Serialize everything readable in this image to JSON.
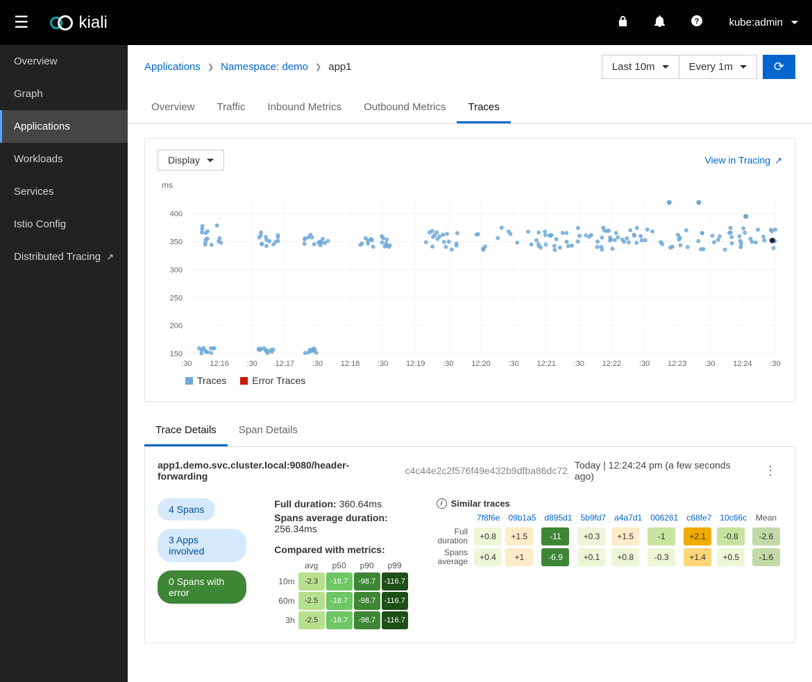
{
  "app_name": "kiali",
  "user": "kube:admin",
  "sidebar": {
    "items": [
      {
        "label": "Overview"
      },
      {
        "label": "Graph"
      },
      {
        "label": "Applications"
      },
      {
        "label": "Workloads"
      },
      {
        "label": "Services"
      },
      {
        "label": "Istio Config"
      },
      {
        "label": "Distributed Tracing"
      }
    ]
  },
  "breadcrumbs": [
    {
      "label": "Applications"
    },
    {
      "label": "Namespace: demo"
    },
    {
      "label": "app1"
    }
  ],
  "time_range": "Last 10m",
  "refresh_interval": "Every 1m",
  "tabs": [
    "Overview",
    "Traffic",
    "Inbound Metrics",
    "Outbound Metrics",
    "Traces"
  ],
  "active_tab": "Traces",
  "display_button": "Display",
  "view_tracing": "View in Tracing",
  "chart_y_label": "ms",
  "legend": {
    "traces": "Traces",
    "errors": "Error Traces"
  },
  "chart_data": {
    "type": "scatter",
    "ylabel": "ms",
    "ylim": [
      150,
      430
    ],
    "y_ticks": [
      150,
      200,
      250,
      300,
      350,
      400
    ],
    "x_ticks": [
      ":30",
      "12:16",
      ":30",
      "12:17",
      ":30",
      "12:18",
      ":30",
      "12:19",
      ":30",
      "12:20",
      ":30",
      "12:21",
      ":30",
      "12:22",
      ":30",
      "12:23",
      ":30",
      "12:24",
      ":30"
    ],
    "series": [
      {
        "name": "Traces",
        "color": "#6ea9d7",
        "approx_count": 260,
        "clusters": [
          {
            "x_range": [
              0.02,
              0.06
            ],
            "y_range": [
              340,
              380
            ]
          },
          {
            "x_range": [
              0.02,
              0.05
            ],
            "y_range": [
              150,
              160
            ]
          },
          {
            "x_range": [
              0.12,
              0.16
            ],
            "y_range": [
              340,
              370
            ]
          },
          {
            "x_range": [
              0.12,
              0.15
            ],
            "y_range": [
              150,
              160
            ]
          },
          {
            "x_range": [
              0.2,
              0.24
            ],
            "y_range": [
              340,
              365
            ]
          },
          {
            "x_range": [
              0.2,
              0.22
            ],
            "y_range": [
              150,
              160
            ]
          },
          {
            "x_range": [
              0.29,
              0.35
            ],
            "y_range": [
              340,
              365
            ]
          },
          {
            "x_range": [
              0.4,
              0.46
            ],
            "y_range": [
              335,
              370
            ]
          },
          {
            "x_range": [
              0.48,
              1.0
            ],
            "y_range": [
              335,
              375
            ]
          }
        ],
        "outliers": [
          {
            "x": 0.82,
            "y": 420
          },
          {
            "x": 0.87,
            "y": 420
          },
          {
            "x": 0.95,
            "y": 395
          }
        ]
      },
      {
        "name": "Error Traces",
        "color": "#c9190b",
        "approx_count": 0,
        "clusters": [],
        "outliers": []
      }
    ]
  },
  "detail_tabs": [
    "Trace Details",
    "Span Details"
  ],
  "active_detail_tab": "Trace Details",
  "trace": {
    "name": "app1.demo.svc.cluster.local:9080/header-forwarding",
    "id": "c4c44e2c2f576f49e432b9dfba86dc72",
    "time": "Today | 12:24:24 pm (a few seconds ago)",
    "badges": {
      "spans": "4 Spans",
      "apps": "3 Apps involved",
      "errors": "0 Spans with error"
    },
    "full_duration_label": "Full duration:",
    "full_duration_value": "360.64ms",
    "avg_duration_label": "Spans average duration:",
    "avg_duration_value": "256.34ms",
    "compared_title": "Compared with metrics:",
    "metrics": {
      "cols": [
        "avg",
        "p50",
        "p90",
        "p99"
      ],
      "rows": [
        {
          "label": "10m",
          "cells": [
            {
              "v": "-2.3",
              "c": "g1"
            },
            {
              "v": "-18.7",
              "c": "g2"
            },
            {
              "v": "-98.7",
              "c": "g3"
            },
            {
              "v": "-116.7",
              "c": "g4"
            }
          ]
        },
        {
          "label": "60m",
          "cells": [
            {
              "v": "-2.5",
              "c": "g1"
            },
            {
              "v": "-18.7",
              "c": "g2"
            },
            {
              "v": "-98.7",
              "c": "g3"
            },
            {
              "v": "-116.7",
              "c": "g4"
            }
          ]
        },
        {
          "label": "3h",
          "cells": [
            {
              "v": "-2.5",
              "c": "g1"
            },
            {
              "v": "-18.7",
              "c": "g2"
            },
            {
              "v": "-98.7",
              "c": "g3"
            },
            {
              "v": "-116.7",
              "c": "g4"
            }
          ]
        }
      ]
    },
    "similar": {
      "title": "Similar traces",
      "cols": [
        "7f8f6e",
        "09b1a5",
        "d895d1",
        "5b9fd7",
        "a4a7d1",
        "006261",
        "c68fe7",
        "10c66c",
        "Mean"
      ],
      "rows": [
        {
          "label": "Full duration",
          "cells": [
            {
              "v": "+0.8",
              "c": "hgl"
            },
            {
              "v": "+1.5",
              "c": "hyl"
            },
            {
              "v": "-11",
              "c": "hgd"
            },
            {
              "v": "+0.3",
              "c": "hgl"
            },
            {
              "v": "+1.5",
              "c": "hyl"
            },
            {
              "v": "-1",
              "c": "hg"
            },
            {
              "v": "+2.1",
              "c": "hyd"
            },
            {
              "v": "-0.8",
              "c": "hg"
            },
            {
              "v": "-2.6",
              "c": "hog"
            }
          ]
        },
        {
          "label": "Spans average",
          "cells": [
            {
              "v": "+0.4",
              "c": "hgl"
            },
            {
              "v": "+1",
              "c": "hyl"
            },
            {
              "v": "-6.9",
              "c": "hgd"
            },
            {
              "v": "+0.1",
              "c": "hgl"
            },
            {
              "v": "+0.8",
              "c": "hgl"
            },
            {
              "v": "-0.3",
              "c": "hgl"
            },
            {
              "v": "+1.4",
              "c": "hy"
            },
            {
              "v": "+0.5",
              "c": "hgl"
            },
            {
              "v": "-1.6",
              "c": "hog"
            }
          ]
        }
      ]
    }
  }
}
